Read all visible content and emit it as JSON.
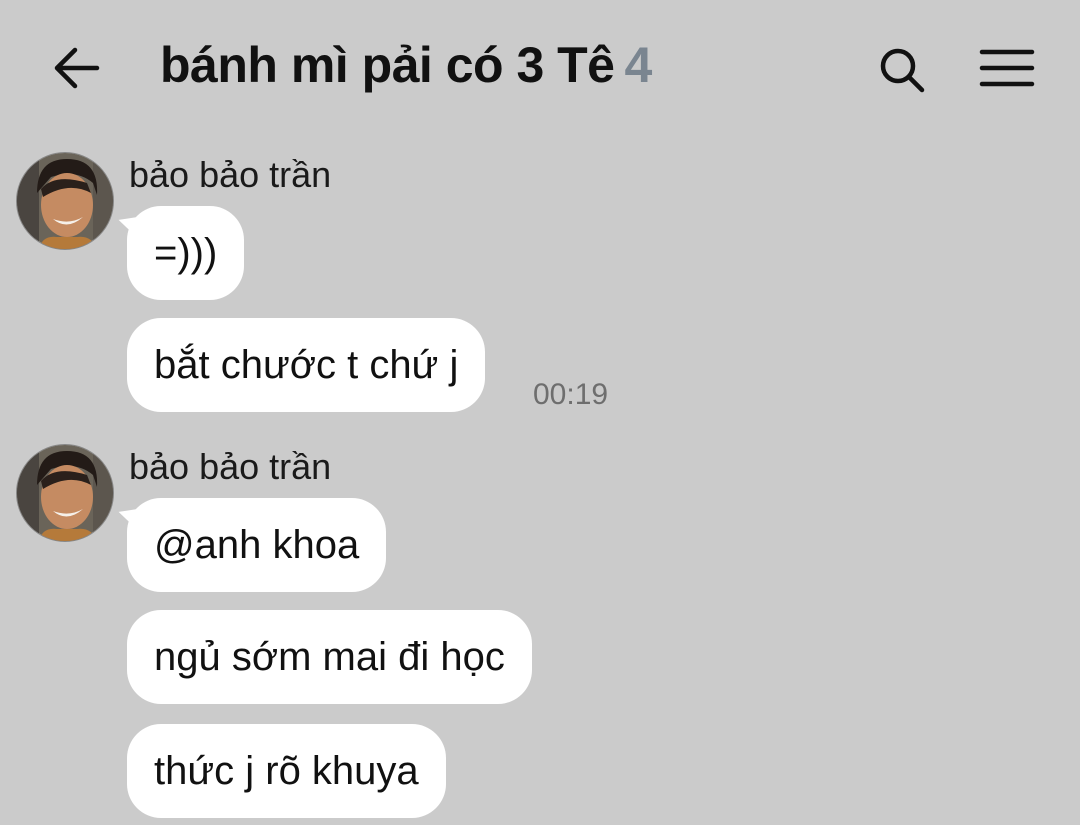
{
  "header": {
    "title": "bánh mì pải có 3 Tê",
    "member_count": "4",
    "back_icon": "arrow-left-icon",
    "search_icon": "search-icon",
    "menu_icon": "hamburger-menu-icon"
  },
  "messages": {
    "group1": {
      "sender": "bảo bảo trần",
      "items": [
        "=)))",
        "bắt chước t chứ j"
      ],
      "time": "00:19"
    },
    "group2": {
      "sender": "bảo bảo trần",
      "items": [
        "@anh khoa",
        "ngủ sớm mai đi học",
        "thức j rõ khuya"
      ]
    }
  },
  "colors": {
    "background": "#cbcbcb",
    "bubble": "#ffffff",
    "member_count": "#7a8590",
    "timestamp": "#6e6e6e"
  }
}
